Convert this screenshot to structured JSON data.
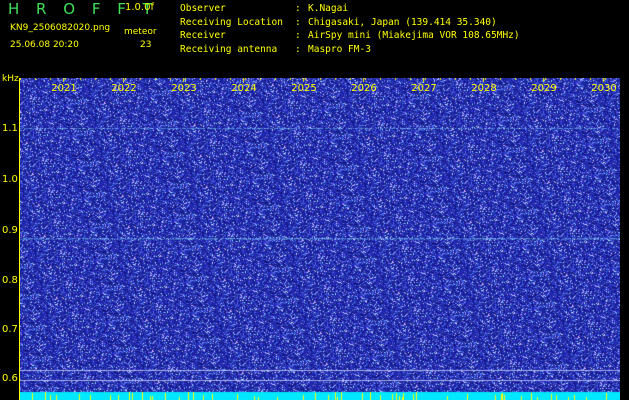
{
  "header": {
    "app_title": "H R O F F T",
    "version": "1.0.0f",
    "filename": "KN9_2506082020.png",
    "event_label": "meteor",
    "datetime": "25.06.08 20:20",
    "event_count": "23"
  },
  "info": [
    {
      "key": "Observer",
      "value": "K.Nagai"
    },
    {
      "key": "Receiving Location",
      "value": "Chigasaki, Japan (139.414 35.340)"
    },
    {
      "key": "Receiver",
      "value": "AirSpy mini (Miakejima VOR 108.65MHz)"
    },
    {
      "key": "Receiving antenna",
      "value": "Maspro FM-3"
    }
  ],
  "chart_data": {
    "type": "heatmap",
    "ylabel": "kHz",
    "yticks": [
      "1.1",
      "1.0",
      "0.9",
      "0.8",
      "0.7",
      "0.6"
    ],
    "xticks": [
      "2021",
      "2022",
      "2023",
      "2024",
      "2025",
      "2026",
      "2027",
      "2028",
      "2029",
      "2030"
    ],
    "colors": {
      "background": "#1a1ea8",
      "noise": "#6a8cff",
      "signal_line": "#7fd8ff",
      "baseline": "#00e8ff",
      "axis": "#ffff00"
    }
  }
}
